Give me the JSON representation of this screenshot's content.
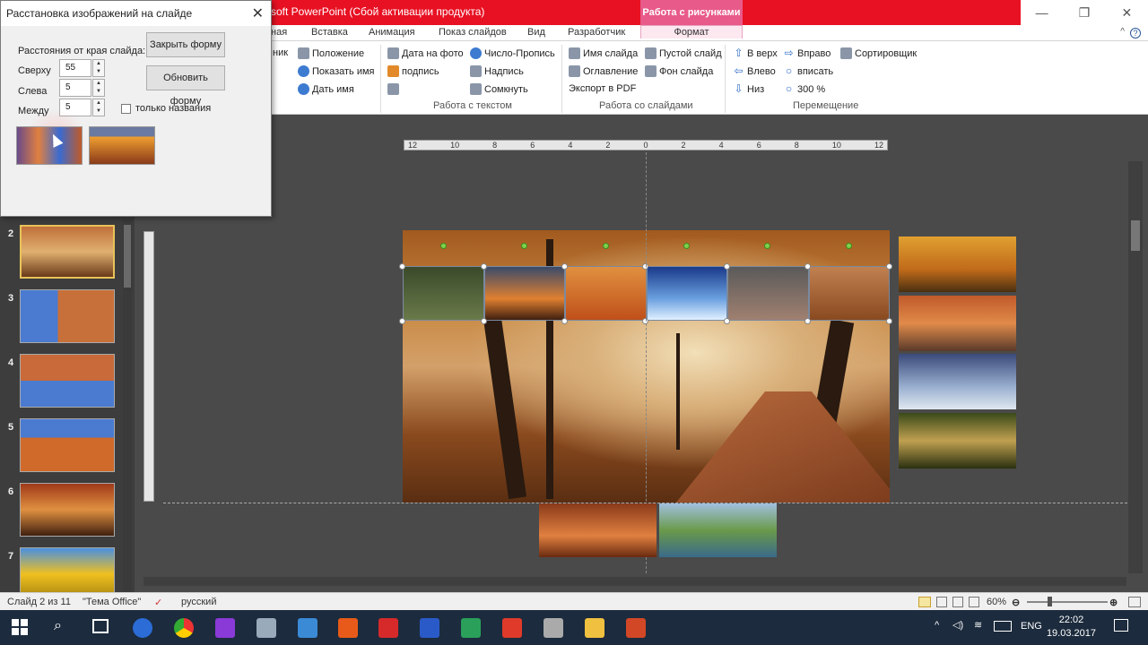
{
  "window": {
    "title": "soft PowerPoint (Сбой активации продукта)",
    "context_header": "Работа с рисунками"
  },
  "ribbon": {
    "tabs": [
      "ная",
      "Вставка",
      "Анимация",
      "Показ слайдов",
      "Вид",
      "Разработчик",
      "Формат"
    ],
    "partial_label": "ник",
    "g1": [
      "Положение",
      "Показать имя",
      "Дать имя"
    ],
    "g2": [
      "Дата на фото",
      "подпись",
      "Число-Пропись",
      "Надпись",
      "Сомкнуть"
    ],
    "g3": [
      "Имя слайда",
      "Оглавление",
      "Экспорт в PDF",
      "Пустой слайд",
      "Фон слайда"
    ],
    "g4": [
      "В верх",
      "Влево",
      "Низ",
      "Вправо",
      "вписать",
      "300 %",
      "Сортировщик"
    ],
    "groups": [
      "Работа с текстом",
      "Работа со слайдами",
      "Перемещение"
    ]
  },
  "ruler": [
    "12",
    "10",
    "8",
    "6",
    "4",
    "2",
    "0",
    "2",
    "4",
    "6",
    "8",
    "10",
    "12"
  ],
  "slides": [
    {
      "num": "2"
    },
    {
      "num": "3"
    },
    {
      "num": "4"
    },
    {
      "num": "5"
    },
    {
      "num": "6"
    },
    {
      "num": "7"
    }
  ],
  "status": {
    "slide": "Слайд 2 из 11",
    "theme": "\"Тема Office\"",
    "language": "русский",
    "zoom": "60%"
  },
  "taskbar": {
    "lang": "ENG",
    "time": "22:02",
    "date": "19.03.2017"
  },
  "dialog": {
    "title": "Расстановка изображений на слайде",
    "edge_label": "Расстояния от края слайда:",
    "top_label": "Сверху",
    "left_label": "Слева",
    "between_label": "Между",
    "top_value": "55",
    "left_value": "5",
    "between_value": "5",
    "close_btn": "Закрыть форму",
    "refresh_btn": "Обновить форму",
    "names_only": "только названия"
  }
}
